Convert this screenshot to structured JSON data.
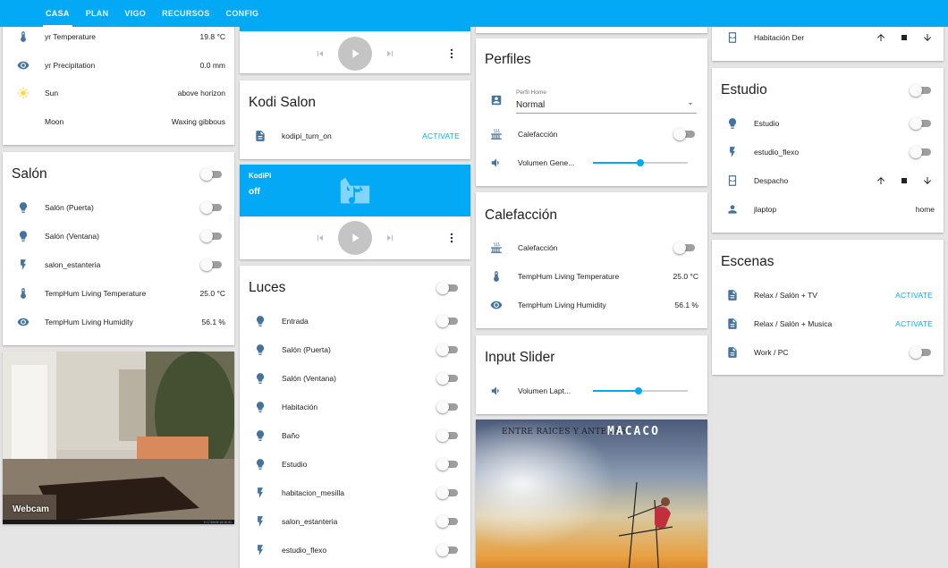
{
  "nav": {
    "tabs": [
      "CASA",
      "PLAN",
      "VIGO",
      "RECURSOS",
      "CONFIG"
    ],
    "active": "CASA"
  },
  "weather": {
    "rows": [
      {
        "label": "yr Temperature",
        "value": "19.8 °C",
        "icon": "thermometer-icon"
      },
      {
        "label": "yr Precipitation",
        "value": "0.0 mm",
        "icon": "eye-icon"
      },
      {
        "label": "Sun",
        "value": "above horizon",
        "icon": "sun-icon"
      },
      {
        "label": "Moon",
        "value": "Waxing gibbous",
        "icon": "moon-icon"
      }
    ]
  },
  "salon": {
    "title": "Salón",
    "rows": [
      {
        "label": "Salón (Puerta)",
        "type": "toggle",
        "icon": "bulb-icon"
      },
      {
        "label": "Salón (Ventana)",
        "type": "toggle",
        "icon": "bulb-icon"
      },
      {
        "label": "salon_estanteria",
        "type": "toggle",
        "icon": "flash-icon"
      },
      {
        "label": "TempHum Living Temperature",
        "value": "25.0 °C",
        "icon": "thermometer-icon"
      },
      {
        "label": "TempHum Living Humidity",
        "value": "56.1 %",
        "icon": "eye-icon"
      }
    ]
  },
  "webcam": {
    "label": "Webcam",
    "timestamp": "0 17:65:08 16:10:41"
  },
  "kodi_salon": {
    "title": "Kodi Salon",
    "script": "kodipi_turn_on",
    "action": "ACTIVATE"
  },
  "kodipi": {
    "name": "KodiPi",
    "state": "off"
  },
  "luces": {
    "title": "Luces",
    "rows": [
      {
        "label": "Entrada",
        "icon": "bulb-icon"
      },
      {
        "label": "Salón (Puerta)",
        "icon": "bulb-icon"
      },
      {
        "label": "Salón (Ventana)",
        "icon": "bulb-icon"
      },
      {
        "label": "Habitación",
        "icon": "bulb-icon"
      },
      {
        "label": "Baño",
        "icon": "bulb-icon"
      },
      {
        "label": "Estudio",
        "icon": "bulb-icon"
      },
      {
        "label": "habitacion_mesilla",
        "icon": "flash-icon"
      },
      {
        "label": "salon_estanteria",
        "icon": "flash-icon"
      },
      {
        "label": "estudio_flexo",
        "icon": "flash-icon"
      }
    ]
  },
  "perfiles": {
    "title": "Perfiles",
    "select_label": "Perfil Home",
    "select_value": "Normal",
    "calefaccion": "Calefacción",
    "volumen": "Volumen Gene...",
    "volumen_level": 0.5
  },
  "calefaccion": {
    "title": "Calefacción",
    "rows": [
      {
        "label": "Calefacción",
        "type": "toggle",
        "icon": "radiator-icon"
      },
      {
        "label": "TempHum Living Temperature",
        "value": "25.0 °C",
        "icon": "thermometer-icon"
      },
      {
        "label": "TempHum Living Humidity",
        "value": "56.1 %",
        "icon": "eye-icon"
      }
    ]
  },
  "input_slider": {
    "title": "Input Slider",
    "label": "Volumen Lapt...",
    "level": 0.48
  },
  "album": {
    "artist": "MACACO",
    "album": "ENTRE RAICES Y ANTENAS"
  },
  "covers_top": {
    "label": "Habitación Der"
  },
  "estudio": {
    "title": "Estudio",
    "rows": [
      {
        "label": "Estudio",
        "type": "toggle",
        "icon": "bulb-icon"
      },
      {
        "label": "estudio_flexo",
        "type": "toggle",
        "icon": "flash-icon"
      },
      {
        "label": "Despacho",
        "type": "cover",
        "icon": "window-icon"
      },
      {
        "label": "jlaptop",
        "value": "home",
        "icon": "person-icon"
      }
    ]
  },
  "escenas": {
    "title": "Escenas",
    "rows": [
      {
        "label": "Relax / Salón + TV",
        "action": "ACTIVATE",
        "icon": "script-icon"
      },
      {
        "label": "Relax / Salón + Musica",
        "action": "ACTIVATE",
        "icon": "script-icon"
      },
      {
        "label": "Work / PC",
        "type": "toggle",
        "icon": "script-icon"
      }
    ]
  },
  "colors": {
    "accent": "#03a9f4",
    "icon": "#44739e",
    "toggle_off": "#9e9e9e"
  }
}
